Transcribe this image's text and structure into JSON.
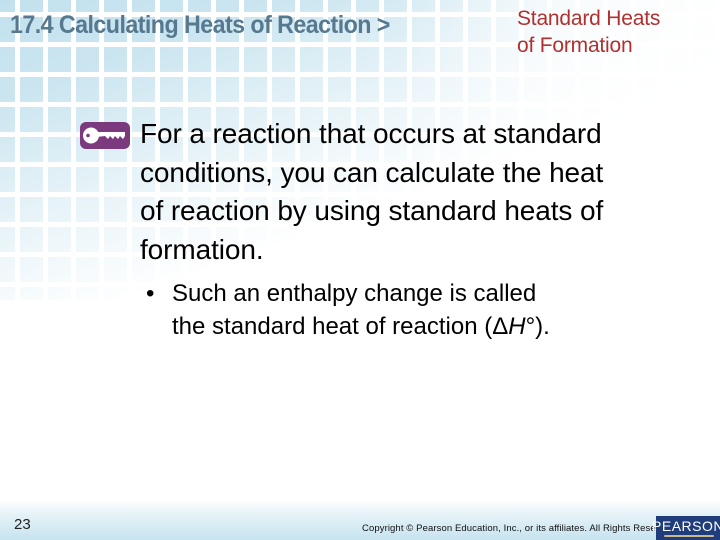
{
  "header": {
    "section_title": "17.4 Calculating Heats of Reaction >",
    "subtitle_line1": "Standard Heats",
    "subtitle_line2": "of Formation"
  },
  "main": {
    "key_icon": "key-icon",
    "key_statement_lines": [
      "For a reaction that occurs at standard",
      "conditions, you can calculate the heat",
      "of reaction by using standard heats of",
      "formation."
    ],
    "bullets": [
      {
        "marker": "•",
        "line1": "Such an enthalpy change is called",
        "line2_prefix": "the standard heat of reaction (Δ",
        "line2_italic": "H",
        "line2_suffix": "°)."
      }
    ]
  },
  "footer": {
    "page_number": "23",
    "copyright": "Copyright © Pearson Education, Inc., or its affiliates. All Rights Reserved.",
    "logo_text": "PEARSON"
  },
  "colors": {
    "title": "#56798f",
    "subtitle": "#b0312f",
    "key_icon_bg": "#7b3a7e",
    "logo_bg": "#1f3d7a",
    "grid": "#c2e1ee"
  }
}
